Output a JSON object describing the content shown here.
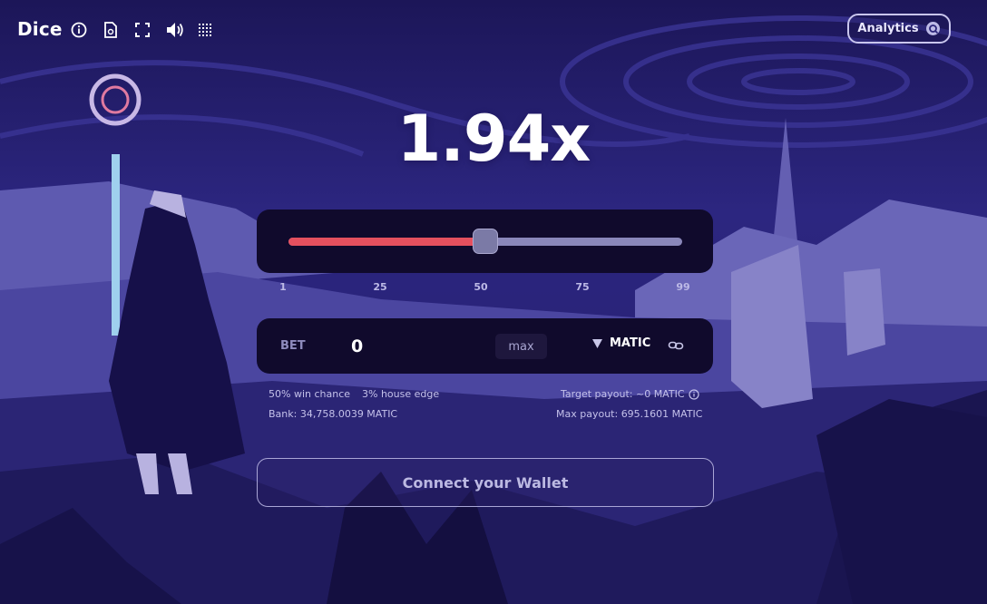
{
  "header": {
    "logo": "Dice",
    "icons": [
      "info-icon",
      "document-icon",
      "fullscreen-icon",
      "volume-icon",
      "grid-icon"
    ],
    "analytics_label": "Analytics"
  },
  "multiplier": "1.94x",
  "slider": {
    "value": 50,
    "min": 1,
    "max": 99,
    "ticks": [
      "1",
      "25",
      "50",
      "75",
      "99"
    ]
  },
  "bet": {
    "label": "BET",
    "value": "0",
    "max_label": "max",
    "token": "MATIC"
  },
  "info": {
    "win_chance": "50% win chance",
    "house_edge": "3% house edge",
    "bank": "Bank: 34,758.0039 MATIC",
    "target_payout": "Target payout: ~0 MATIC",
    "max_payout": "Max payout: 695.1601 MATIC"
  },
  "connect_label": "Connect your Wallet",
  "colors": {
    "background": "#2a2478",
    "panel": "#100a2c",
    "slider_fill": "#e5505f",
    "slider_track": "#8a87ba"
  }
}
